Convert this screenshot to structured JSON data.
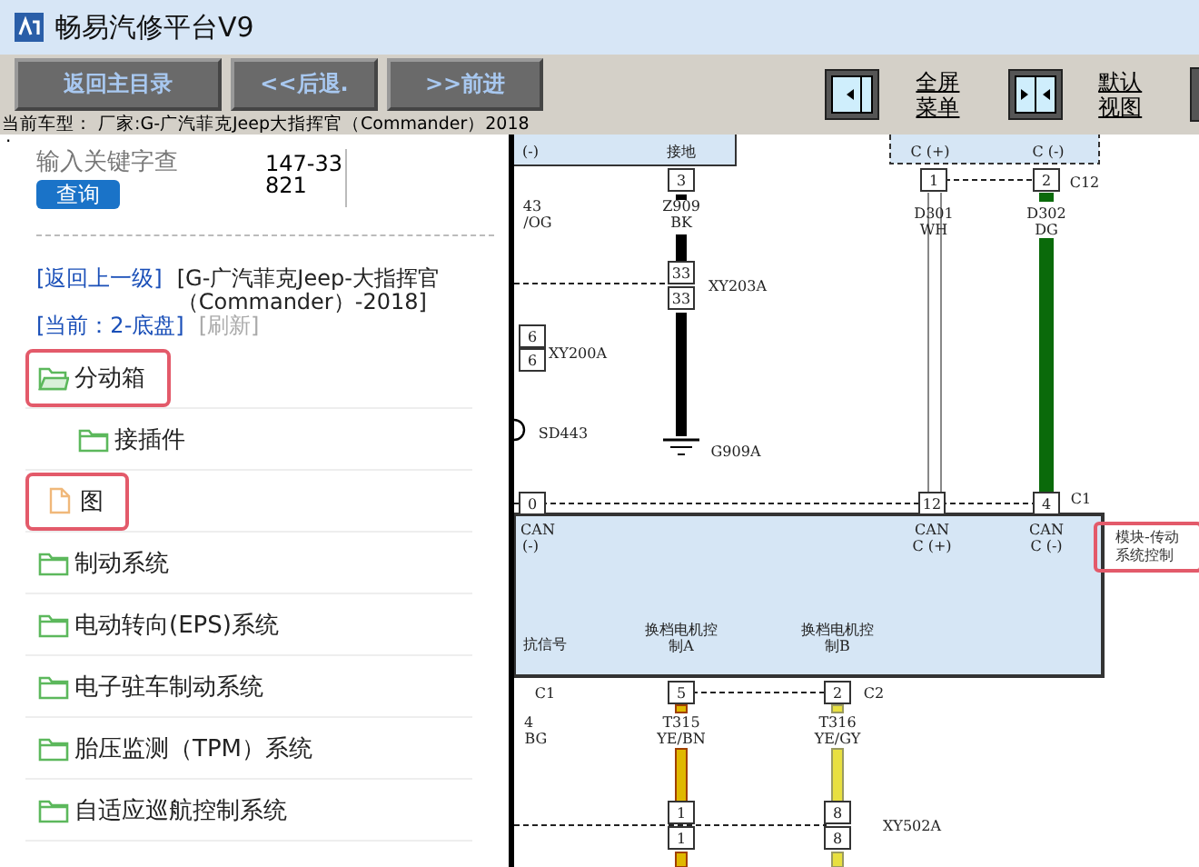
{
  "window": {
    "title": "畅易汽修平台V9"
  },
  "toolbar": {
    "buttons": [
      "返回主目录",
      "<<后退.",
      ">>前进"
    ],
    "view_links": [
      "全屏菜单",
      "默认视图"
    ],
    "model_line": "当前车型： 厂家:G-广汽菲克Jeep大指挥官（Commander）2018"
  },
  "sidebar": {
    "bullet": ".",
    "search": {
      "placeholder": "输入关键字查",
      "code": "147-33821",
      "button": "查询"
    },
    "nav": {
      "back": "[返回上一级]",
      "path": "[G-广汽菲克Jeep-大指挥官（Commander）-2018]",
      "current": "[当前：2-底盘]",
      "refresh": "[刷新]"
    },
    "tree": [
      {
        "label": "分动箱",
        "kind": "folder",
        "expanded": true,
        "highlighted": true,
        "children": [
          {
            "label": "接插件",
            "kind": "folder",
            "expanded": false,
            "highlighted": false
          }
        ]
      },
      {
        "label": "图",
        "kind": "file",
        "highlighted": true
      },
      {
        "label": "制动系统",
        "kind": "folder",
        "expanded": false,
        "highlighted": false
      },
      {
        "label": "电动转向(EPS)系统",
        "kind": "folder",
        "expanded": false,
        "highlighted": false
      },
      {
        "label": "电子驻车制动系统",
        "kind": "folder",
        "expanded": false,
        "highlighted": false
      },
      {
        "label": "胎压监测（TPM）系统",
        "kind": "folder",
        "expanded": false,
        "highlighted": false
      },
      {
        "label": "自适应巡航控制系统",
        "kind": "folder",
        "expanded": false,
        "highlighted": false
      }
    ]
  },
  "diagram": {
    "labels": [
      {
        "text": "(-)",
        "kind": "caption"
      },
      {
        "text": "接地",
        "kind": "caption"
      },
      {
        "text": "C (+)",
        "kind": "caption"
      },
      {
        "text": "C (-)",
        "kind": "caption"
      },
      {
        "text": "3",
        "kind": "pin"
      },
      {
        "text": "1",
        "kind": "pin"
      },
      {
        "text": "2",
        "kind": "pin"
      },
      {
        "text": "C12",
        "kind": "caption"
      },
      {
        "text": "43",
        "kind": "caption"
      },
      {
        "text": "/OG",
        "kind": "caption"
      },
      {
        "text": "Z909",
        "kind": "caption"
      },
      {
        "text": "BK",
        "kind": "caption"
      },
      {
        "text": "D301",
        "kind": "caption"
      },
      {
        "text": "WH",
        "kind": "caption"
      },
      {
        "text": "D302",
        "kind": "caption"
      },
      {
        "text": "DG",
        "kind": "caption"
      },
      {
        "text": "33",
        "kind": "pin"
      },
      {
        "text": "33",
        "kind": "pin"
      },
      {
        "text": "XY203A",
        "kind": "caption"
      },
      {
        "text": "6",
        "kind": "pin"
      },
      {
        "text": "6",
        "kind": "pin"
      },
      {
        "text": "XY200A",
        "kind": "caption"
      },
      {
        "text": "SD443",
        "kind": "caption"
      },
      {
        "text": "G909A",
        "kind": "caption"
      },
      {
        "text": "0",
        "kind": "pin"
      },
      {
        "text": "12",
        "kind": "pin"
      },
      {
        "text": "4",
        "kind": "pin"
      },
      {
        "text": "C1",
        "kind": "caption"
      },
      {
        "text": "CAN",
        "kind": "caption"
      },
      {
        "text": "(-)",
        "kind": "caption"
      },
      {
        "text": "CAN",
        "kind": "caption"
      },
      {
        "text": "C (+)",
        "kind": "caption"
      },
      {
        "text": "CAN",
        "kind": "caption"
      },
      {
        "text": "C (-)",
        "kind": "caption"
      },
      {
        "text": "抗信号",
        "kind": "caption"
      },
      {
        "text": "换档电机控",
        "kind": "caption"
      },
      {
        "text": "制A",
        "kind": "caption"
      },
      {
        "text": "换档电机控",
        "kind": "caption"
      },
      {
        "text": "制B",
        "kind": "caption"
      },
      {
        "text": "C1",
        "kind": "caption"
      },
      {
        "text": "5",
        "kind": "pin"
      },
      {
        "text": "2",
        "kind": "pin"
      },
      {
        "text": "C2",
        "kind": "caption"
      },
      {
        "text": "4",
        "kind": "caption"
      },
      {
        "text": "BG",
        "kind": "caption"
      },
      {
        "text": "T315",
        "kind": "caption"
      },
      {
        "text": "YE/BN",
        "kind": "caption"
      },
      {
        "text": "T316",
        "kind": "caption"
      },
      {
        "text": "YE/GY",
        "kind": "caption"
      },
      {
        "text": "1",
        "kind": "pin"
      },
      {
        "text": "1",
        "kind": "pin"
      },
      {
        "text": "8",
        "kind": "pin"
      },
      {
        "text": "8",
        "kind": "pin"
      },
      {
        "text": "XY502A",
        "kind": "caption"
      }
    ],
    "module_label": {
      "text": "模块-传动系统控制",
      "highlighted": true
    }
  }
}
